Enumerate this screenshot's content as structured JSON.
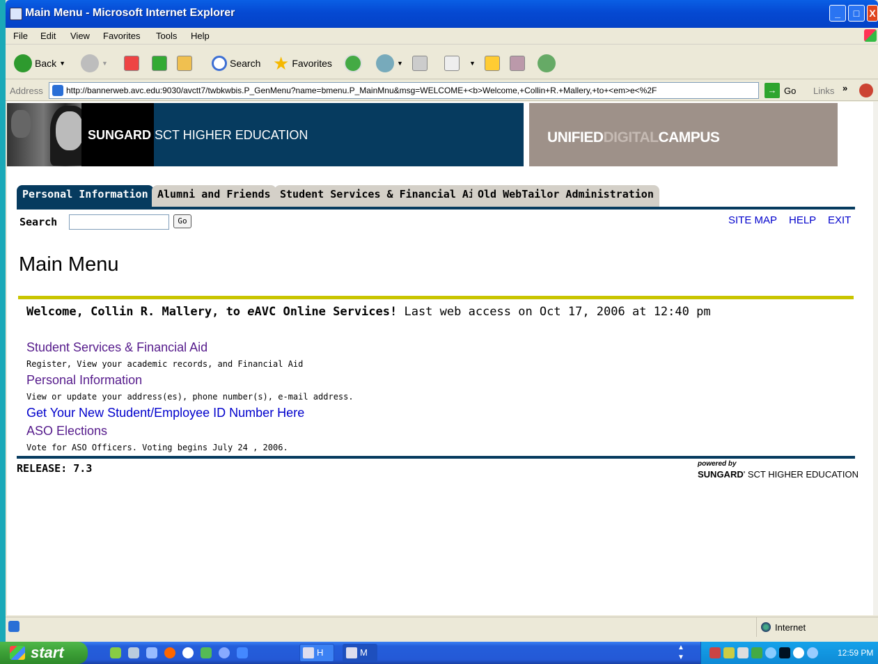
{
  "window": {
    "title": "Main Menu - Microsoft Internet Explorer",
    "controls": {
      "minimize": "_",
      "maximize": "□",
      "close": "X"
    }
  },
  "menubar": [
    "File",
    "Edit",
    "View",
    "Favorites",
    "Tools",
    "Help"
  ],
  "toolbar": {
    "back": "Back",
    "search": "Search",
    "favorites": "Favorites",
    "icons": [
      "back-icon",
      "forward-icon",
      "stop-icon",
      "refresh-icon",
      "home-icon",
      "search-icon",
      "favorites-icon",
      "history-icon",
      "mail-icon",
      "print-icon",
      "edit-icon",
      "discuss-icon",
      "research-icon",
      "messenger-icon"
    ]
  },
  "address_bar": {
    "label": "Address",
    "url": "http://bannerweb.avc.edu:9030/avctt7/twbkwbis.P_GenMenu?name=bmenu.P_MainMnu&msg=WELCOME+<b>Welcome,+Collin+R.+Mallery,+to+<em>e<%2F",
    "go": "Go",
    "links": "Links",
    "links_chevron": "»"
  },
  "banner": {
    "logo_bold": "SUNGARD",
    "logo_rest": " SCT HIGHER EDUCATION",
    "udc_a": "UNIFIED",
    "udc_b": "DIGITAL",
    "udc_c": "CAMPUS"
  },
  "tabs": [
    {
      "label": "Personal Information",
      "active": true
    },
    {
      "label": "Alumni and Friends",
      "active": false
    },
    {
      "label": "Student Services & Financial Aid",
      "active": false
    },
    {
      "label": "Old WebTailor Administration",
      "active": false
    }
  ],
  "search": {
    "label": "Search",
    "value": "",
    "go": "Go"
  },
  "top_links": {
    "site_map": "SITE MAP",
    "help": "HELP",
    "exit": "EXIT"
  },
  "main": {
    "title": "Main Menu",
    "welcome_a": "Welcome, Collin R. Mallery, to ",
    "welcome_em": "e",
    "welcome_b": "AVC Online Services!",
    "welcome_c": " Last web access on Oct 17, 2006 at 12:40 pm",
    "menu": [
      {
        "label": "Student Services & Financial Aid",
        "desc": "Register, View your academic records, and Financial Aid"
      },
      {
        "label": "Personal Information",
        "desc": "View or update your address(es), phone number(s), e-mail address."
      },
      {
        "label": "Get Your New Student/Employee ID Number Here",
        "desc": ""
      },
      {
        "label": "ASO Elections",
        "desc": "Vote for ASO Officers. Voting begins July 24 , 2006."
      }
    ]
  },
  "footer": {
    "release": "RELEASE: 7.3",
    "powered_by": "powered by",
    "logo_bold": "SUNGARD",
    "logo_rest": "' SCT HIGHER EDUCATION"
  },
  "statusbar": {
    "zone": "Internet"
  },
  "taskbar": {
    "start": "start",
    "tasks": [
      {
        "label": "H"
      },
      {
        "label": "M"
      }
    ],
    "clock": "12:59 PM"
  },
  "colors": {
    "banner_navy": "#063b5f",
    "banner_taupe": "#9e9189",
    "rule_yellow": "#c9c500",
    "link_visited": "#551a8b",
    "link_blue": "#0000cc"
  }
}
